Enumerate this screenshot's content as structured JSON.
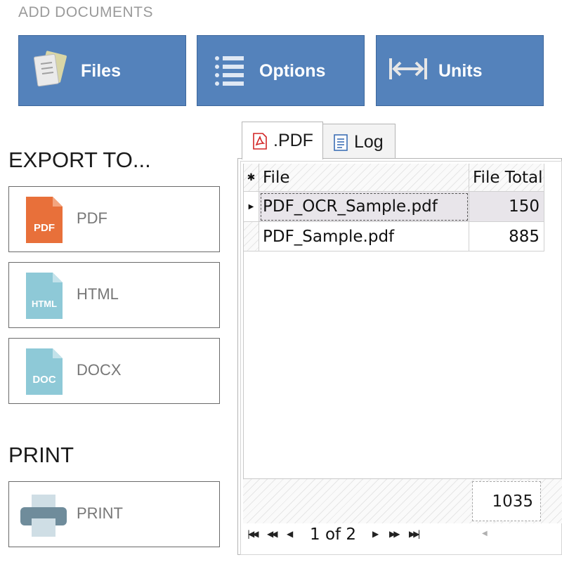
{
  "header": {
    "title": "ADD DOCUMENTS",
    "buttons": [
      {
        "label": "Files",
        "icon": "files-icon"
      },
      {
        "label": "Options",
        "icon": "options-list-icon"
      },
      {
        "label": "Units",
        "icon": "units-arrows-icon"
      }
    ]
  },
  "export": {
    "title": "EXPORT TO...",
    "buttons": [
      {
        "label": "PDF",
        "icon_text": "PDF",
        "color": "#e8703a"
      },
      {
        "label": "HTML",
        "icon_text": "HTML",
        "color": "#8ec9d7"
      },
      {
        "label": "DOCX",
        "icon_text": "DOC",
        "color": "#8ec9d7"
      }
    ]
  },
  "print": {
    "title": "PRINT",
    "button_label": "PRINT"
  },
  "tabs": [
    {
      "label": ".PDF",
      "active": true,
      "icon": "pdf-icon"
    },
    {
      "label": "Log",
      "active": false,
      "icon": "log-icon"
    }
  ],
  "grid": {
    "columns": [
      "File",
      "File Total"
    ],
    "rows": [
      {
        "file": "PDF_OCR_Sample.pdf",
        "total": "150",
        "selected": true
      },
      {
        "file": "PDF_Sample.pdf",
        "total": "885",
        "selected": false
      }
    ],
    "grand_total": "1035"
  },
  "pager": {
    "text": "1 of 2"
  },
  "colors": {
    "accent": "#5482bb",
    "pdf_orange": "#e8703a",
    "doc_teal": "#8ec9d7"
  }
}
